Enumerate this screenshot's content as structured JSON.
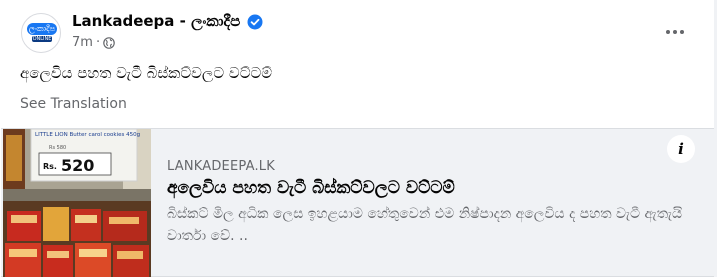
{
  "post": {
    "page_name": "Lankadeepa - ලංකාදීප",
    "time": "7m",
    "separator": "·",
    "text": "අලෙවිය පහත වැටී බිස්කට්වලට වට්ටම්",
    "see_translation": "See Translation",
    "avatar_text": "ලංකාදීප",
    "avatar_sub": "ONLINE"
  },
  "link_preview": {
    "domain": "LANKADEEPA.LK",
    "title": "අලෙවිය පහත වැටී බිස්කට්වලට වට්ටම්",
    "description": "බිස්කට් මිල අධික ලෙස ඉහළයාම හේතුවෙන් එම නිෂ්පාදන අලෙවිය ද පහත වැටී ඇතැයි වාර්තා වේ. ..",
    "info_label": "i",
    "thumbnail": {
      "price_tag_heading": "LITTLE LION Butter carol cookies 450g",
      "price_tag_sub": "Rs 580",
      "price_currency": "Rs.",
      "price_value": "520"
    }
  },
  "colors": {
    "brand": "#1877f2",
    "verified": "#1877f2",
    "secondary_text": "#65676b",
    "card_bg": "#f0f2f5"
  },
  "icons": {
    "verified": "verified-badge-icon",
    "privacy": "globe-icon",
    "more": "more-options-icon",
    "info": "info-icon"
  }
}
